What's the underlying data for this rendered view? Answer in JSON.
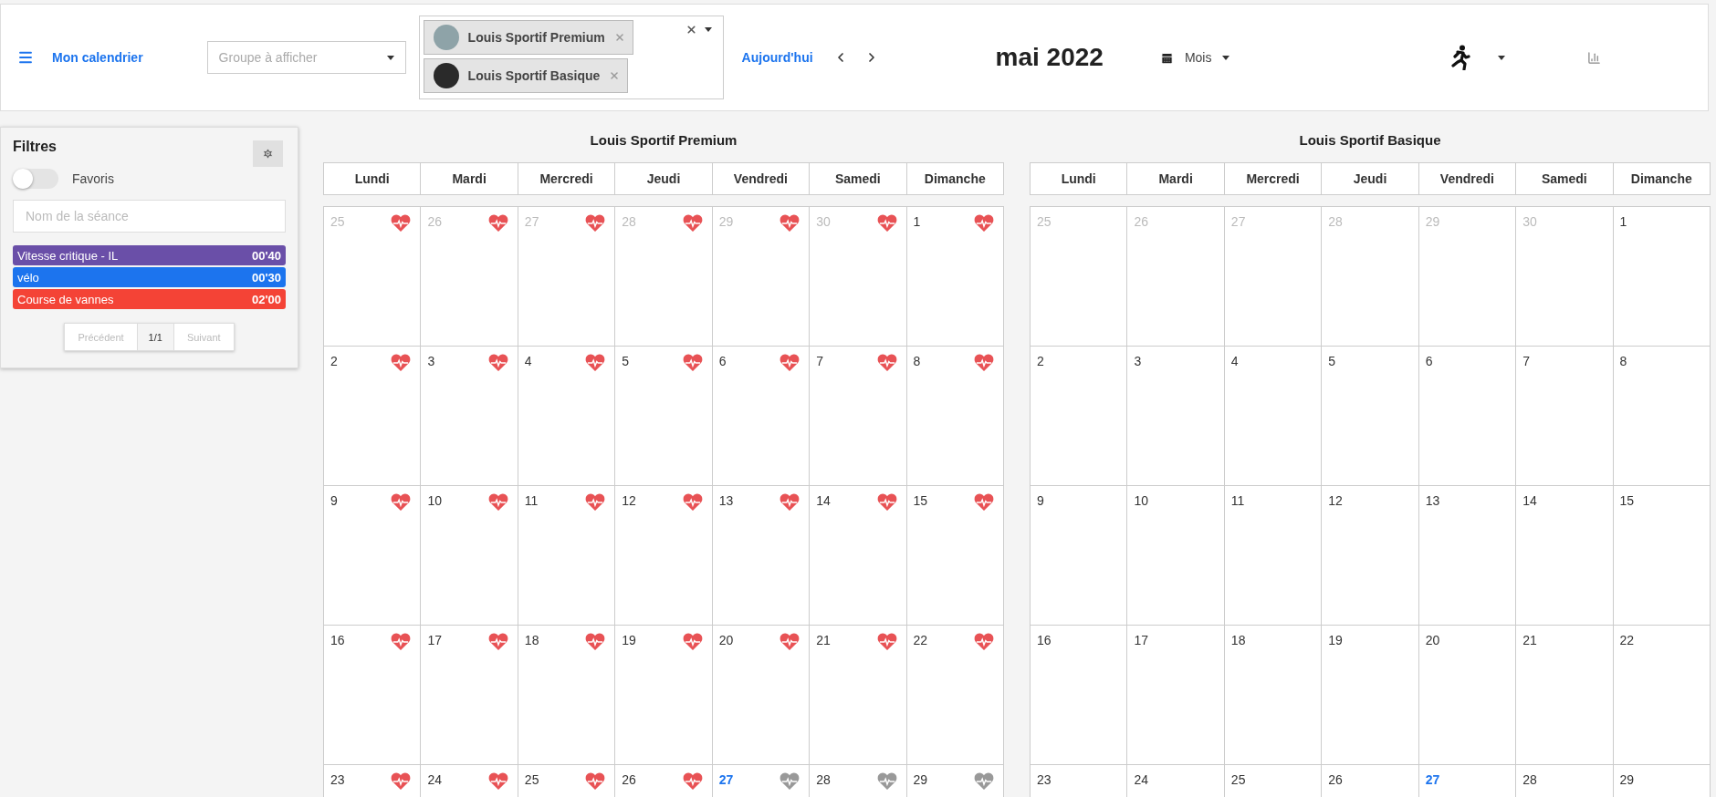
{
  "top_bar": {
    "title": "Mon calendrier",
    "group_select": {
      "placeholder": "Groupe à afficher"
    },
    "athletes": [
      {
        "label": "Louis Sportif Premium"
      },
      {
        "label": "Louis Sportif Basique"
      }
    ],
    "today_button": "Aujourd'hui",
    "month": "mai 2022",
    "view_select": "Mois"
  },
  "filters": {
    "title": "Filtres",
    "favorites": {
      "label": "Favoris",
      "on": false
    },
    "search": {
      "placeholder": "Nom de la séance"
    },
    "sessions": [
      {
        "name": "Vitesse critique - IL",
        "duration": "00'40",
        "color": "#6a4fa8"
      },
      {
        "name": "vélo",
        "duration": "00'30",
        "color": "#1c74ee"
      },
      {
        "name": "Course de vannes",
        "duration": "02'00",
        "color": "#f44336"
      }
    ],
    "pagination": {
      "previous": {
        "label": "Précédent",
        "disabled": true
      },
      "page": "1/1",
      "next": {
        "label": "Suivant",
        "disabled": true
      }
    }
  },
  "calendars": [
    {
      "title": "Louis Sportif Premium",
      "weekdays": [
        "Lundi",
        "Mardi",
        "Mercredi",
        "Jeudi",
        "Vendredi",
        "Samedi",
        "Dimanche"
      ],
      "weeks": [
        [
          {
            "day": "25",
            "outside_month": true,
            "today": false,
            "heart_active": true
          },
          {
            "day": "26",
            "outside_month": true,
            "today": false,
            "heart_active": true
          },
          {
            "day": "27",
            "outside_month": true,
            "today": false,
            "heart_active": true
          },
          {
            "day": "28",
            "outside_month": true,
            "today": false,
            "heart_active": true
          },
          {
            "day": "29",
            "outside_month": true,
            "today": false,
            "heart_active": true
          },
          {
            "day": "30",
            "outside_month": true,
            "today": false,
            "heart_active": true
          },
          {
            "day": "1",
            "outside_month": false,
            "today": false,
            "heart_active": true
          }
        ],
        [
          {
            "day": "2",
            "outside_month": false,
            "today": false,
            "heart_active": true
          },
          {
            "day": "3",
            "outside_month": false,
            "today": false,
            "heart_active": true
          },
          {
            "day": "4",
            "outside_month": false,
            "today": false,
            "heart_active": true
          },
          {
            "day": "5",
            "outside_month": false,
            "today": false,
            "heart_active": true
          },
          {
            "day": "6",
            "outside_month": false,
            "today": false,
            "heart_active": true
          },
          {
            "day": "7",
            "outside_month": false,
            "today": false,
            "heart_active": true
          },
          {
            "day": "8",
            "outside_month": false,
            "today": false,
            "heart_active": true
          }
        ],
        [
          {
            "day": "9",
            "outside_month": false,
            "today": false,
            "heart_active": true
          },
          {
            "day": "10",
            "outside_month": false,
            "today": false,
            "heart_active": true
          },
          {
            "day": "11",
            "outside_month": false,
            "today": false,
            "heart_active": true
          },
          {
            "day": "12",
            "outside_month": false,
            "today": false,
            "heart_active": true
          },
          {
            "day": "13",
            "outside_month": false,
            "today": false,
            "heart_active": true
          },
          {
            "day": "14",
            "outside_month": false,
            "today": false,
            "heart_active": true
          },
          {
            "day": "15",
            "outside_month": false,
            "today": false,
            "heart_active": true
          }
        ],
        [
          {
            "day": "16",
            "outside_month": false,
            "today": false,
            "heart_active": true
          },
          {
            "day": "17",
            "outside_month": false,
            "today": false,
            "heart_active": true
          },
          {
            "day": "18",
            "outside_month": false,
            "today": false,
            "heart_active": true
          },
          {
            "day": "19",
            "outside_month": false,
            "today": false,
            "heart_active": true
          },
          {
            "day": "20",
            "outside_month": false,
            "today": false,
            "heart_active": true
          },
          {
            "day": "21",
            "outside_month": false,
            "today": false,
            "heart_active": true
          },
          {
            "day": "22",
            "outside_month": false,
            "today": false,
            "heart_active": true
          }
        ],
        [
          {
            "day": "23",
            "outside_month": false,
            "today": false,
            "heart_active": true
          },
          {
            "day": "24",
            "outside_month": false,
            "today": false,
            "heart_active": true
          },
          {
            "day": "25",
            "outside_month": false,
            "today": false,
            "heart_active": true
          },
          {
            "day": "26",
            "outside_month": false,
            "today": false,
            "heart_active": true
          },
          {
            "day": "27",
            "outside_month": false,
            "today": true,
            "heart_active": false
          },
          {
            "day": "28",
            "outside_month": false,
            "today": false,
            "heart_active": false
          },
          {
            "day": "29",
            "outside_month": false,
            "today": false,
            "heart_active": false
          }
        ]
      ]
    },
    {
      "title": "Louis Sportif Basique",
      "weekdays": [
        "Lundi",
        "Mardi",
        "Mercredi",
        "Jeudi",
        "Vendredi",
        "Samedi",
        "Dimanche"
      ],
      "weeks": [
        [
          {
            "day": "25",
            "outside_month": true,
            "today": false
          },
          {
            "day": "26",
            "outside_month": true,
            "today": false
          },
          {
            "day": "27",
            "outside_month": true,
            "today": false
          },
          {
            "day": "28",
            "outside_month": true,
            "today": false
          },
          {
            "day": "29",
            "outside_month": true,
            "today": false
          },
          {
            "day": "30",
            "outside_month": true,
            "today": false
          },
          {
            "day": "1",
            "outside_month": false,
            "today": false
          }
        ],
        [
          {
            "day": "2",
            "outside_month": false,
            "today": false
          },
          {
            "day": "3",
            "outside_month": false,
            "today": false
          },
          {
            "day": "4",
            "outside_month": false,
            "today": false
          },
          {
            "day": "5",
            "outside_month": false,
            "today": false
          },
          {
            "day": "6",
            "outside_month": false,
            "today": false
          },
          {
            "day": "7",
            "outside_month": false,
            "today": false
          },
          {
            "day": "8",
            "outside_month": false,
            "today": false
          }
        ],
        [
          {
            "day": "9",
            "outside_month": false,
            "today": false
          },
          {
            "day": "10",
            "outside_month": false,
            "today": false
          },
          {
            "day": "11",
            "outside_month": false,
            "today": false
          },
          {
            "day": "12",
            "outside_month": false,
            "today": false
          },
          {
            "day": "13",
            "outside_month": false,
            "today": false
          },
          {
            "day": "14",
            "outside_month": false,
            "today": false
          },
          {
            "day": "15",
            "outside_month": false,
            "today": false
          }
        ],
        [
          {
            "day": "16",
            "outside_month": false,
            "today": false
          },
          {
            "day": "17",
            "outside_month": false,
            "today": false
          },
          {
            "day": "18",
            "outside_month": false,
            "today": false
          },
          {
            "day": "19",
            "outside_month": false,
            "today": false
          },
          {
            "day": "20",
            "outside_month": false,
            "today": false
          },
          {
            "day": "21",
            "outside_month": false,
            "today": false
          },
          {
            "day": "22",
            "outside_month": false,
            "today": false
          }
        ],
        [
          {
            "day": "23",
            "outside_month": false,
            "today": false
          },
          {
            "day": "24",
            "outside_month": false,
            "today": false
          },
          {
            "day": "25",
            "outside_month": false,
            "today": false
          },
          {
            "day": "26",
            "outside_month": false,
            "today": false
          },
          {
            "day": "27",
            "outside_month": false,
            "today": true
          },
          {
            "day": "28",
            "outside_month": false,
            "today": false
          },
          {
            "day": "29",
            "outside_month": false,
            "today": false
          }
        ]
      ]
    }
  ]
}
